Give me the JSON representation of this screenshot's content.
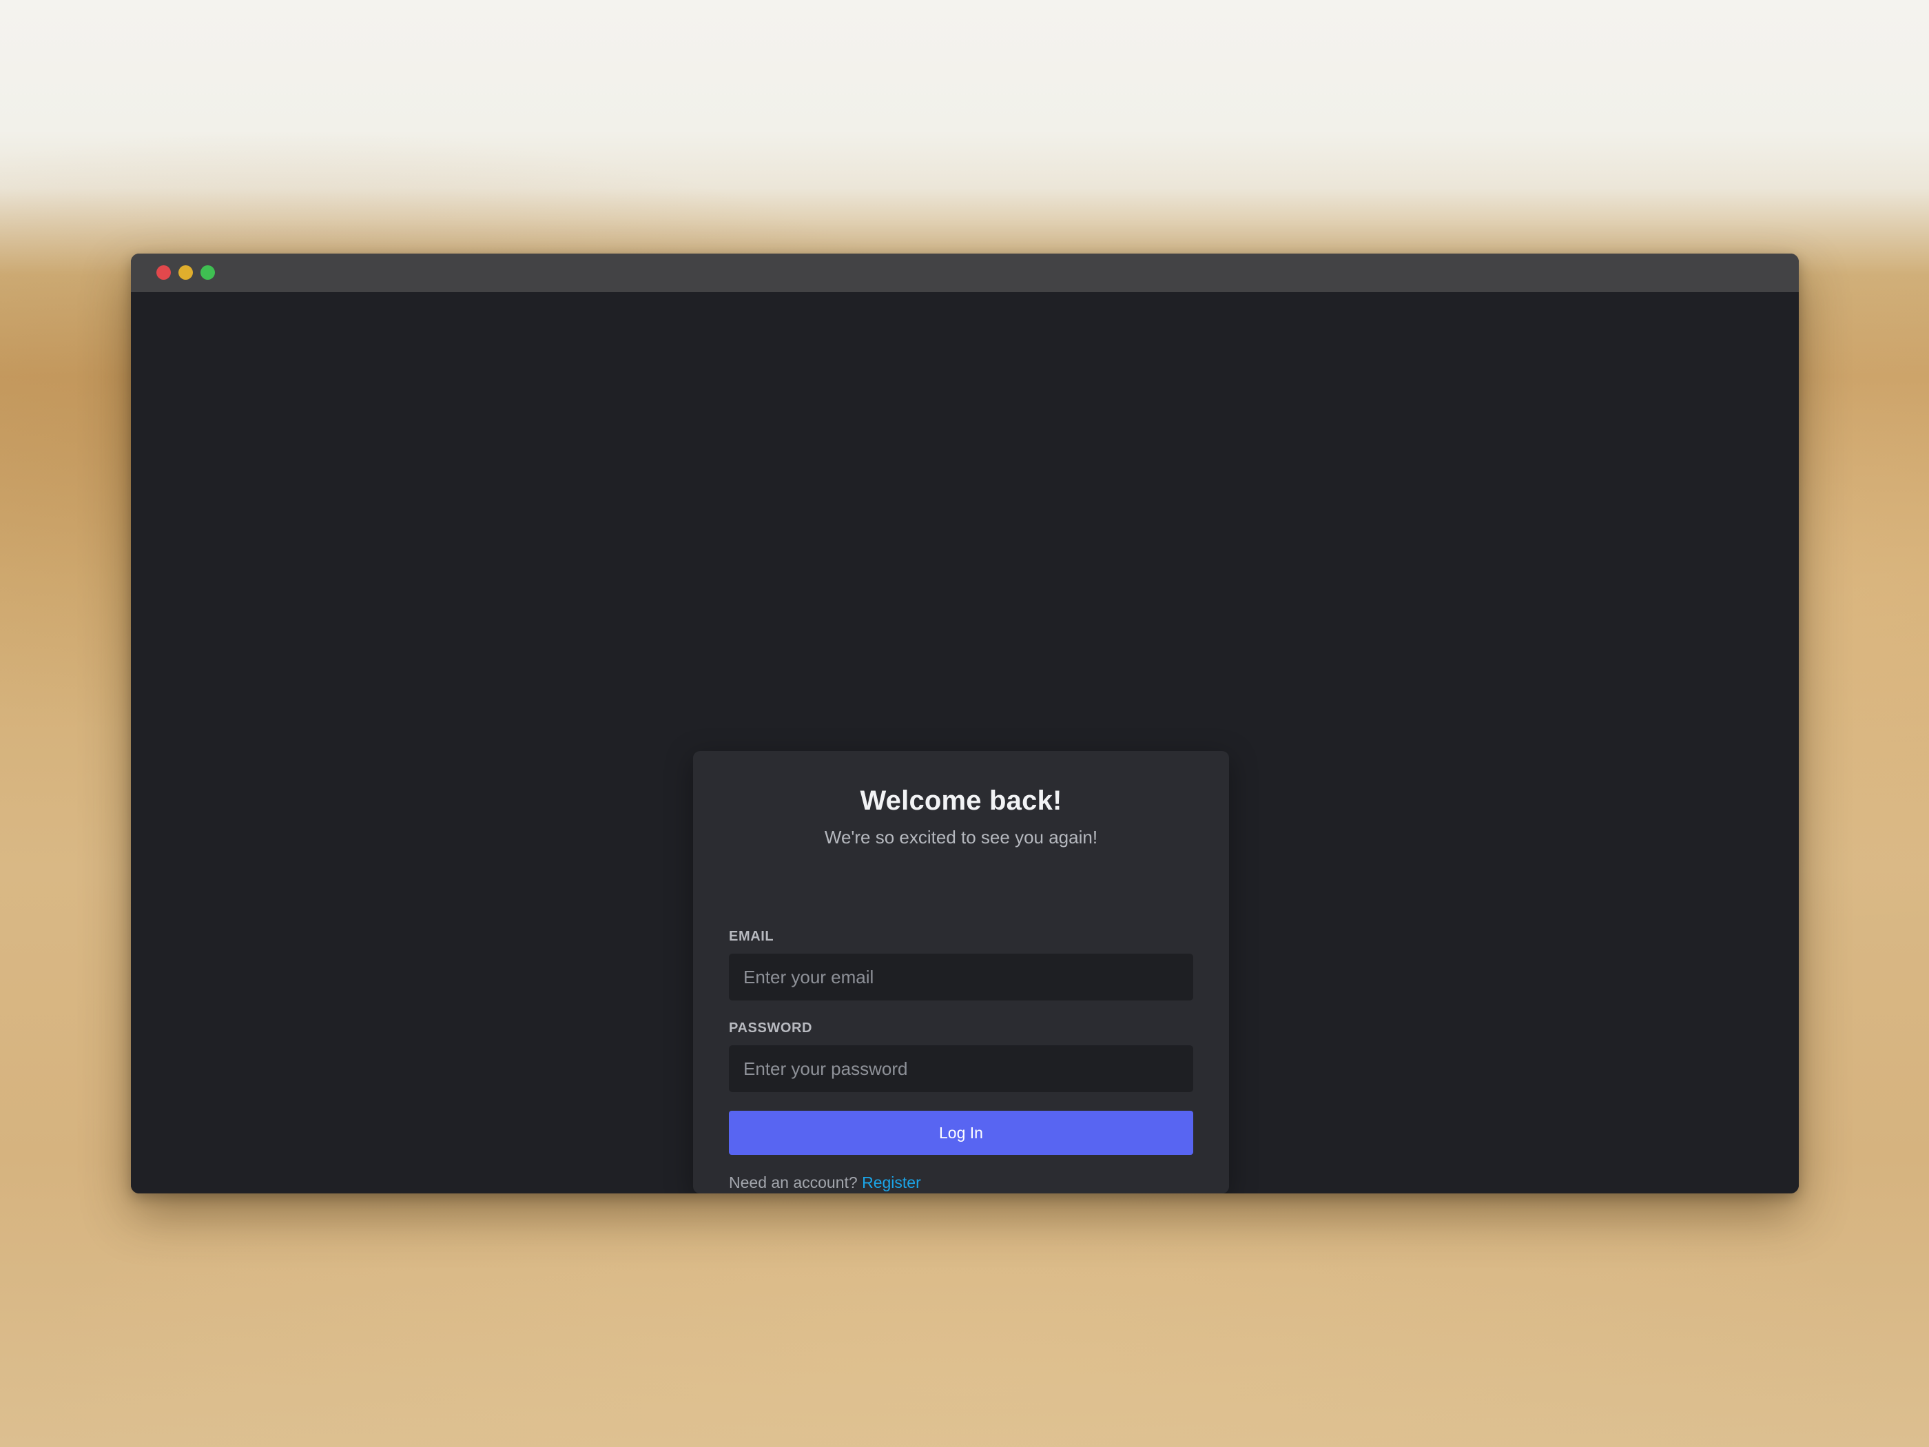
{
  "window": {
    "controls": [
      "close",
      "minimize",
      "maximize"
    ]
  },
  "login": {
    "title": "Welcome back!",
    "subtitle": "We're so excited to see you again!",
    "email_label": "EMAIL",
    "email_placeholder": "Enter your email",
    "email_value": "",
    "password_label": "PASSWORD",
    "password_placeholder": "Enter your password",
    "password_value": "",
    "login_button_label": "Log In",
    "register_prompt": "Need an account?",
    "register_link_label": "Register"
  },
  "colors": {
    "window_background": "#1f2025",
    "titlebar": "#434345",
    "card_background": "#2b2c31",
    "input_background": "#1e1f23",
    "accent_button": "#5865f2",
    "link": "#1ba5e8",
    "close_dot": "#e2484c",
    "minimize_dot": "#e0ae2d",
    "maximize_dot": "#3fbf52"
  }
}
